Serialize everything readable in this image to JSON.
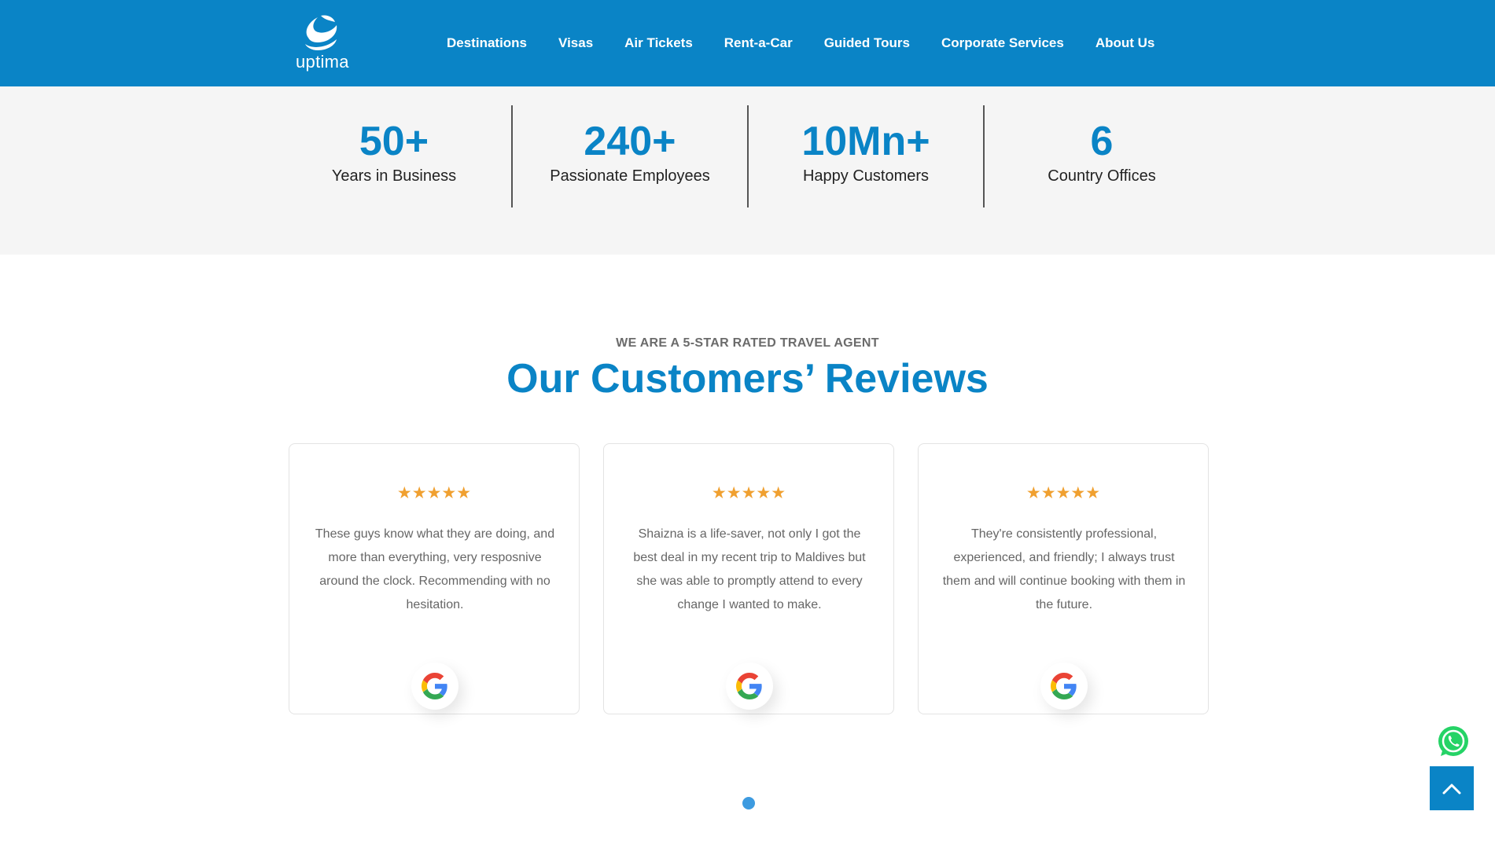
{
  "header": {
    "logo_text": "uptima",
    "nav": [
      "Destinations",
      "Visas",
      "Air Tickets",
      "Rent-a-Car",
      "Guided Tours",
      "Corporate Services",
      "About Us"
    ]
  },
  "stats": [
    {
      "value": "50+",
      "label": "Years in Business"
    },
    {
      "value": "240+",
      "label": "Passionate Employees"
    },
    {
      "value": "10Mn+",
      "label": "Happy Customers"
    },
    {
      "value": "6",
      "label": "Country Offices"
    }
  ],
  "reviews_section": {
    "eyebrow": "WE ARE A 5-STAR RATED TRAVEL AGENT",
    "title": "Our Customers’ Reviews"
  },
  "reviews": [
    {
      "rating": 5,
      "stars": "★★★★★",
      "text": "These guys know what they are doing, and more than everything, very resposnive around the clock. Recommending with no hesitation.",
      "source_icon": "google-icon"
    },
    {
      "rating": 5,
      "stars": "★★★★★",
      "text": "Shaizna is a life-saver, not only I got the best deal in my recent trip to Maldives but she was able to promptly attend to every change I wanted to make.",
      "source_icon": "google-icon"
    },
    {
      "rating": 5,
      "stars": "★★★★★",
      "text": "They're consistently professional, experienced, and friendly; I always trust them and will continue booking with them in the future.",
      "source_icon": "google-icon"
    }
  ],
  "colors": {
    "brand": "#0a84c6",
    "star": "#f0a030",
    "stats_bg": "#f5f5f5",
    "whatsapp": "#25d366"
  }
}
